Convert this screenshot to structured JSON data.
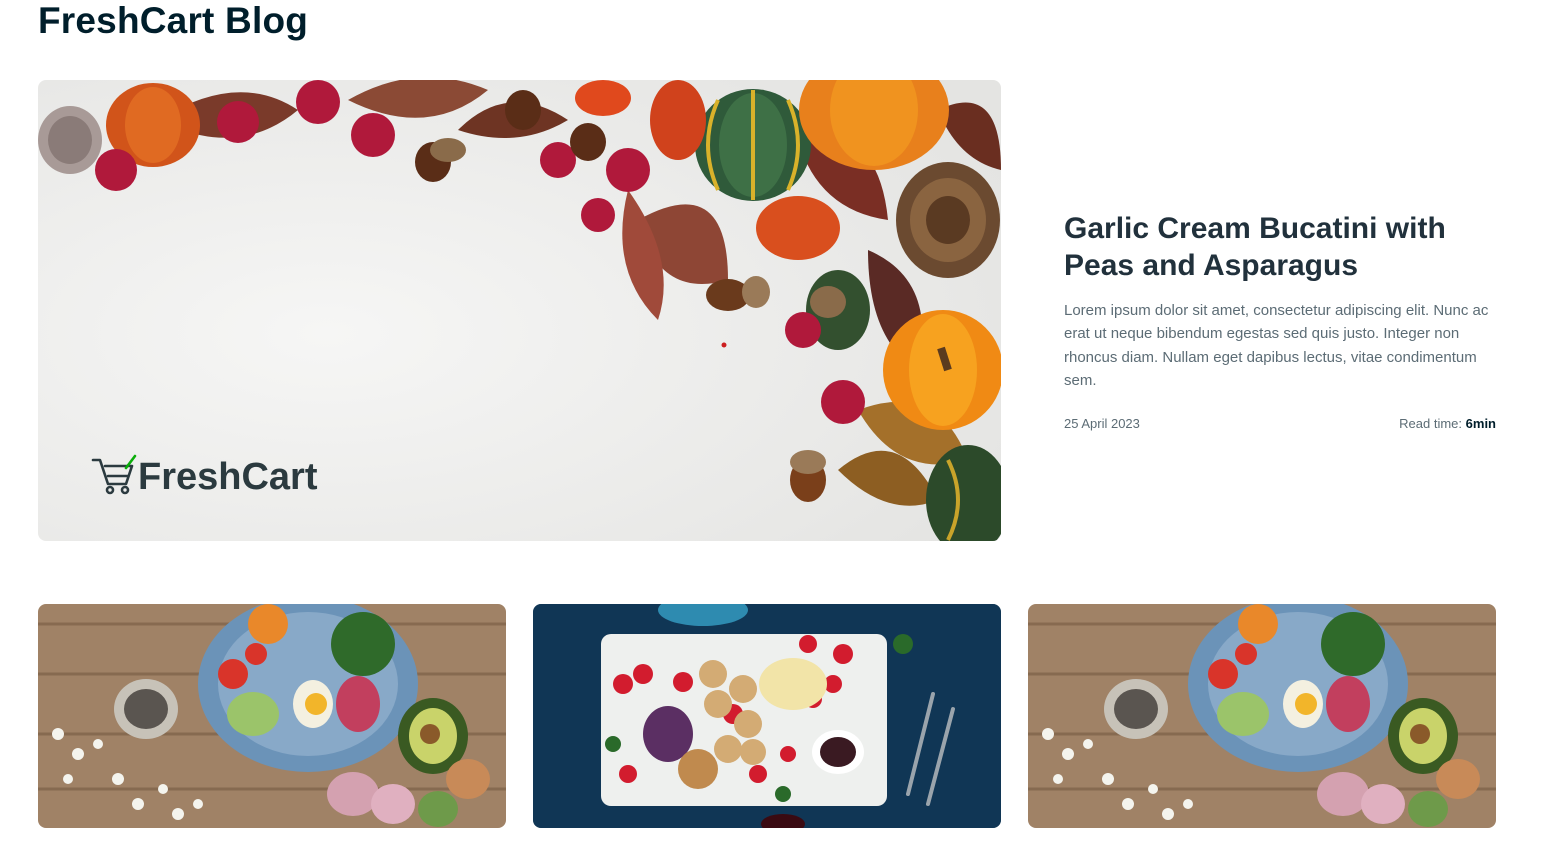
{
  "page": {
    "title": "FreshCart Blog"
  },
  "featured_post": {
    "image_brand_text": "FreshCart",
    "title": "Garlic Cream Bucatini with Peas and Asparagus",
    "excerpt": "Lorem ipsum dolor sit amet, consectetur adipiscing elit. Nunc ac erat ut neque bibendum egestas sed quis justo. Integer non rhoncus diam. Nullam eget dapibus lectus, vitae condimentum sem.",
    "date": "25 April 2023",
    "read_time_label": "Read time:",
    "read_time_value": "6min"
  },
  "colors": {
    "heading": "#001e2b",
    "text": "#21313c",
    "muted": "#5c6c75",
    "brand_green": "#0aad0a"
  }
}
